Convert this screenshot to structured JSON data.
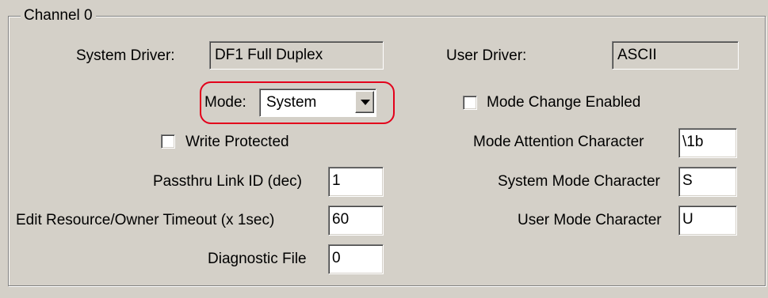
{
  "group": {
    "title": "Channel 0"
  },
  "system_driver": {
    "label": "System Driver:",
    "value": "DF1 Full Duplex"
  },
  "user_driver": {
    "label": "User Driver:",
    "value": "ASCII"
  },
  "mode": {
    "label": "Mode:",
    "value": "System"
  },
  "mode_change": {
    "label": "Mode Change Enabled",
    "checked": false
  },
  "write_protected": {
    "label": "Write Protected",
    "checked": false
  },
  "mode_attention": {
    "label": "Mode Attention Character",
    "value": "\\1b"
  },
  "passthru": {
    "label": "Passthru Link ID (dec)",
    "value": "1"
  },
  "system_mode_char": {
    "label": "System Mode Character",
    "value": "S"
  },
  "timeout": {
    "label": "Edit Resource/Owner Timeout (x 1sec)",
    "value": "60"
  },
  "user_mode_char": {
    "label": "User Mode Character",
    "value": "U"
  },
  "diagnostic": {
    "label": "Diagnostic File",
    "value": "0"
  },
  "colors": {
    "face": "#d4d0c8",
    "highlight_ring": "#e3001b"
  }
}
